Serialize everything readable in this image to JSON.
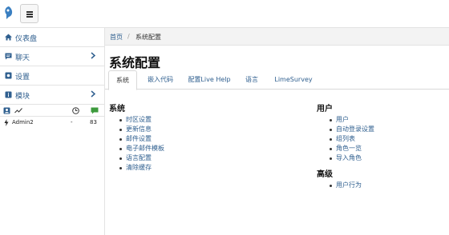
{
  "topbar": {
    "menu_label": "menu"
  },
  "sidebar": {
    "items": [
      {
        "label": "仪表盘",
        "icon": "home-icon"
      },
      {
        "label": "聊天",
        "icon": "chat-icon"
      },
      {
        "label": "设置",
        "icon": "settings-icon"
      },
      {
        "label": "模块",
        "icon": "info-icon"
      }
    ],
    "stats_row": {
      "user": "Admin2",
      "time": "-",
      "count": "83"
    }
  },
  "breadcrumb": {
    "home": "首页",
    "separator": "/",
    "current": "系统配置"
  },
  "page": {
    "title": "系统配置"
  },
  "tabs": [
    {
      "label": "系统"
    },
    {
      "label": "嵌入代码"
    },
    {
      "label": "配置Live Help"
    },
    {
      "label": "语言"
    },
    {
      "label": "LimeSurvey"
    }
  ],
  "system_section": {
    "title": "系统",
    "links": [
      "时区设置",
      "更新信息",
      "邮件设置",
      "电子邮件模板",
      "语言配置",
      "清除缓存"
    ]
  },
  "users_section": {
    "title": "用户",
    "links": [
      "用户",
      "自动登录设置",
      "组列表",
      "角色一览",
      "导入角色"
    ]
  },
  "advanced_section": {
    "title": "高级",
    "links": [
      "用户行为"
    ]
  },
  "colors": {
    "link": "#2f5f8f",
    "accent_green": "#3c9a3c",
    "logo_blue": "#3a7fc1"
  }
}
